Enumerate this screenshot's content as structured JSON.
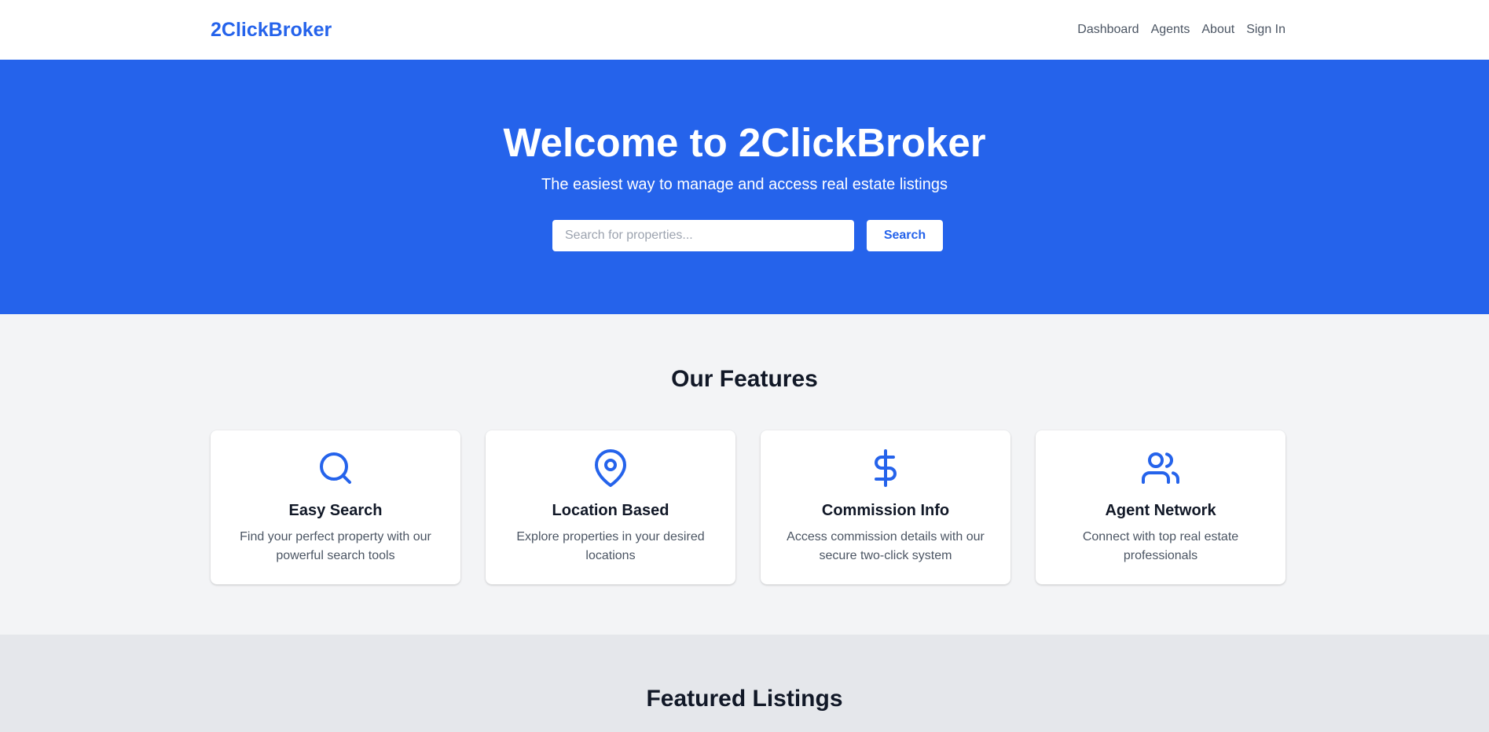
{
  "nav": {
    "brand": "2ClickBroker",
    "links": [
      "Dashboard",
      "Agents",
      "About",
      "Sign In"
    ]
  },
  "hero": {
    "title": "Welcome to 2ClickBroker",
    "subtitle": "The easiest way to manage and access real estate listings",
    "search_placeholder": "Search for properties...",
    "search_value": "",
    "search_button": "Search"
  },
  "features": {
    "title": "Our Features",
    "items": [
      {
        "icon": "search-icon",
        "title": "Easy Search",
        "description": "Find your perfect property with our powerful search tools"
      },
      {
        "icon": "map-pin-icon",
        "title": "Location Based",
        "description": "Explore properties in your desired locations"
      },
      {
        "icon": "dollar-sign-icon",
        "title": "Commission Info",
        "description": "Access commission details with our secure two-click system"
      },
      {
        "icon": "users-icon",
        "title": "Agent Network",
        "description": "Connect with top real estate professionals"
      }
    ]
  },
  "listings": {
    "title": "Featured Listings"
  },
  "colors": {
    "primary": "#2563eb",
    "page_bg": "#f3f4f6",
    "listings_bg": "#e5e7eb",
    "text_muted": "#4b5563"
  }
}
